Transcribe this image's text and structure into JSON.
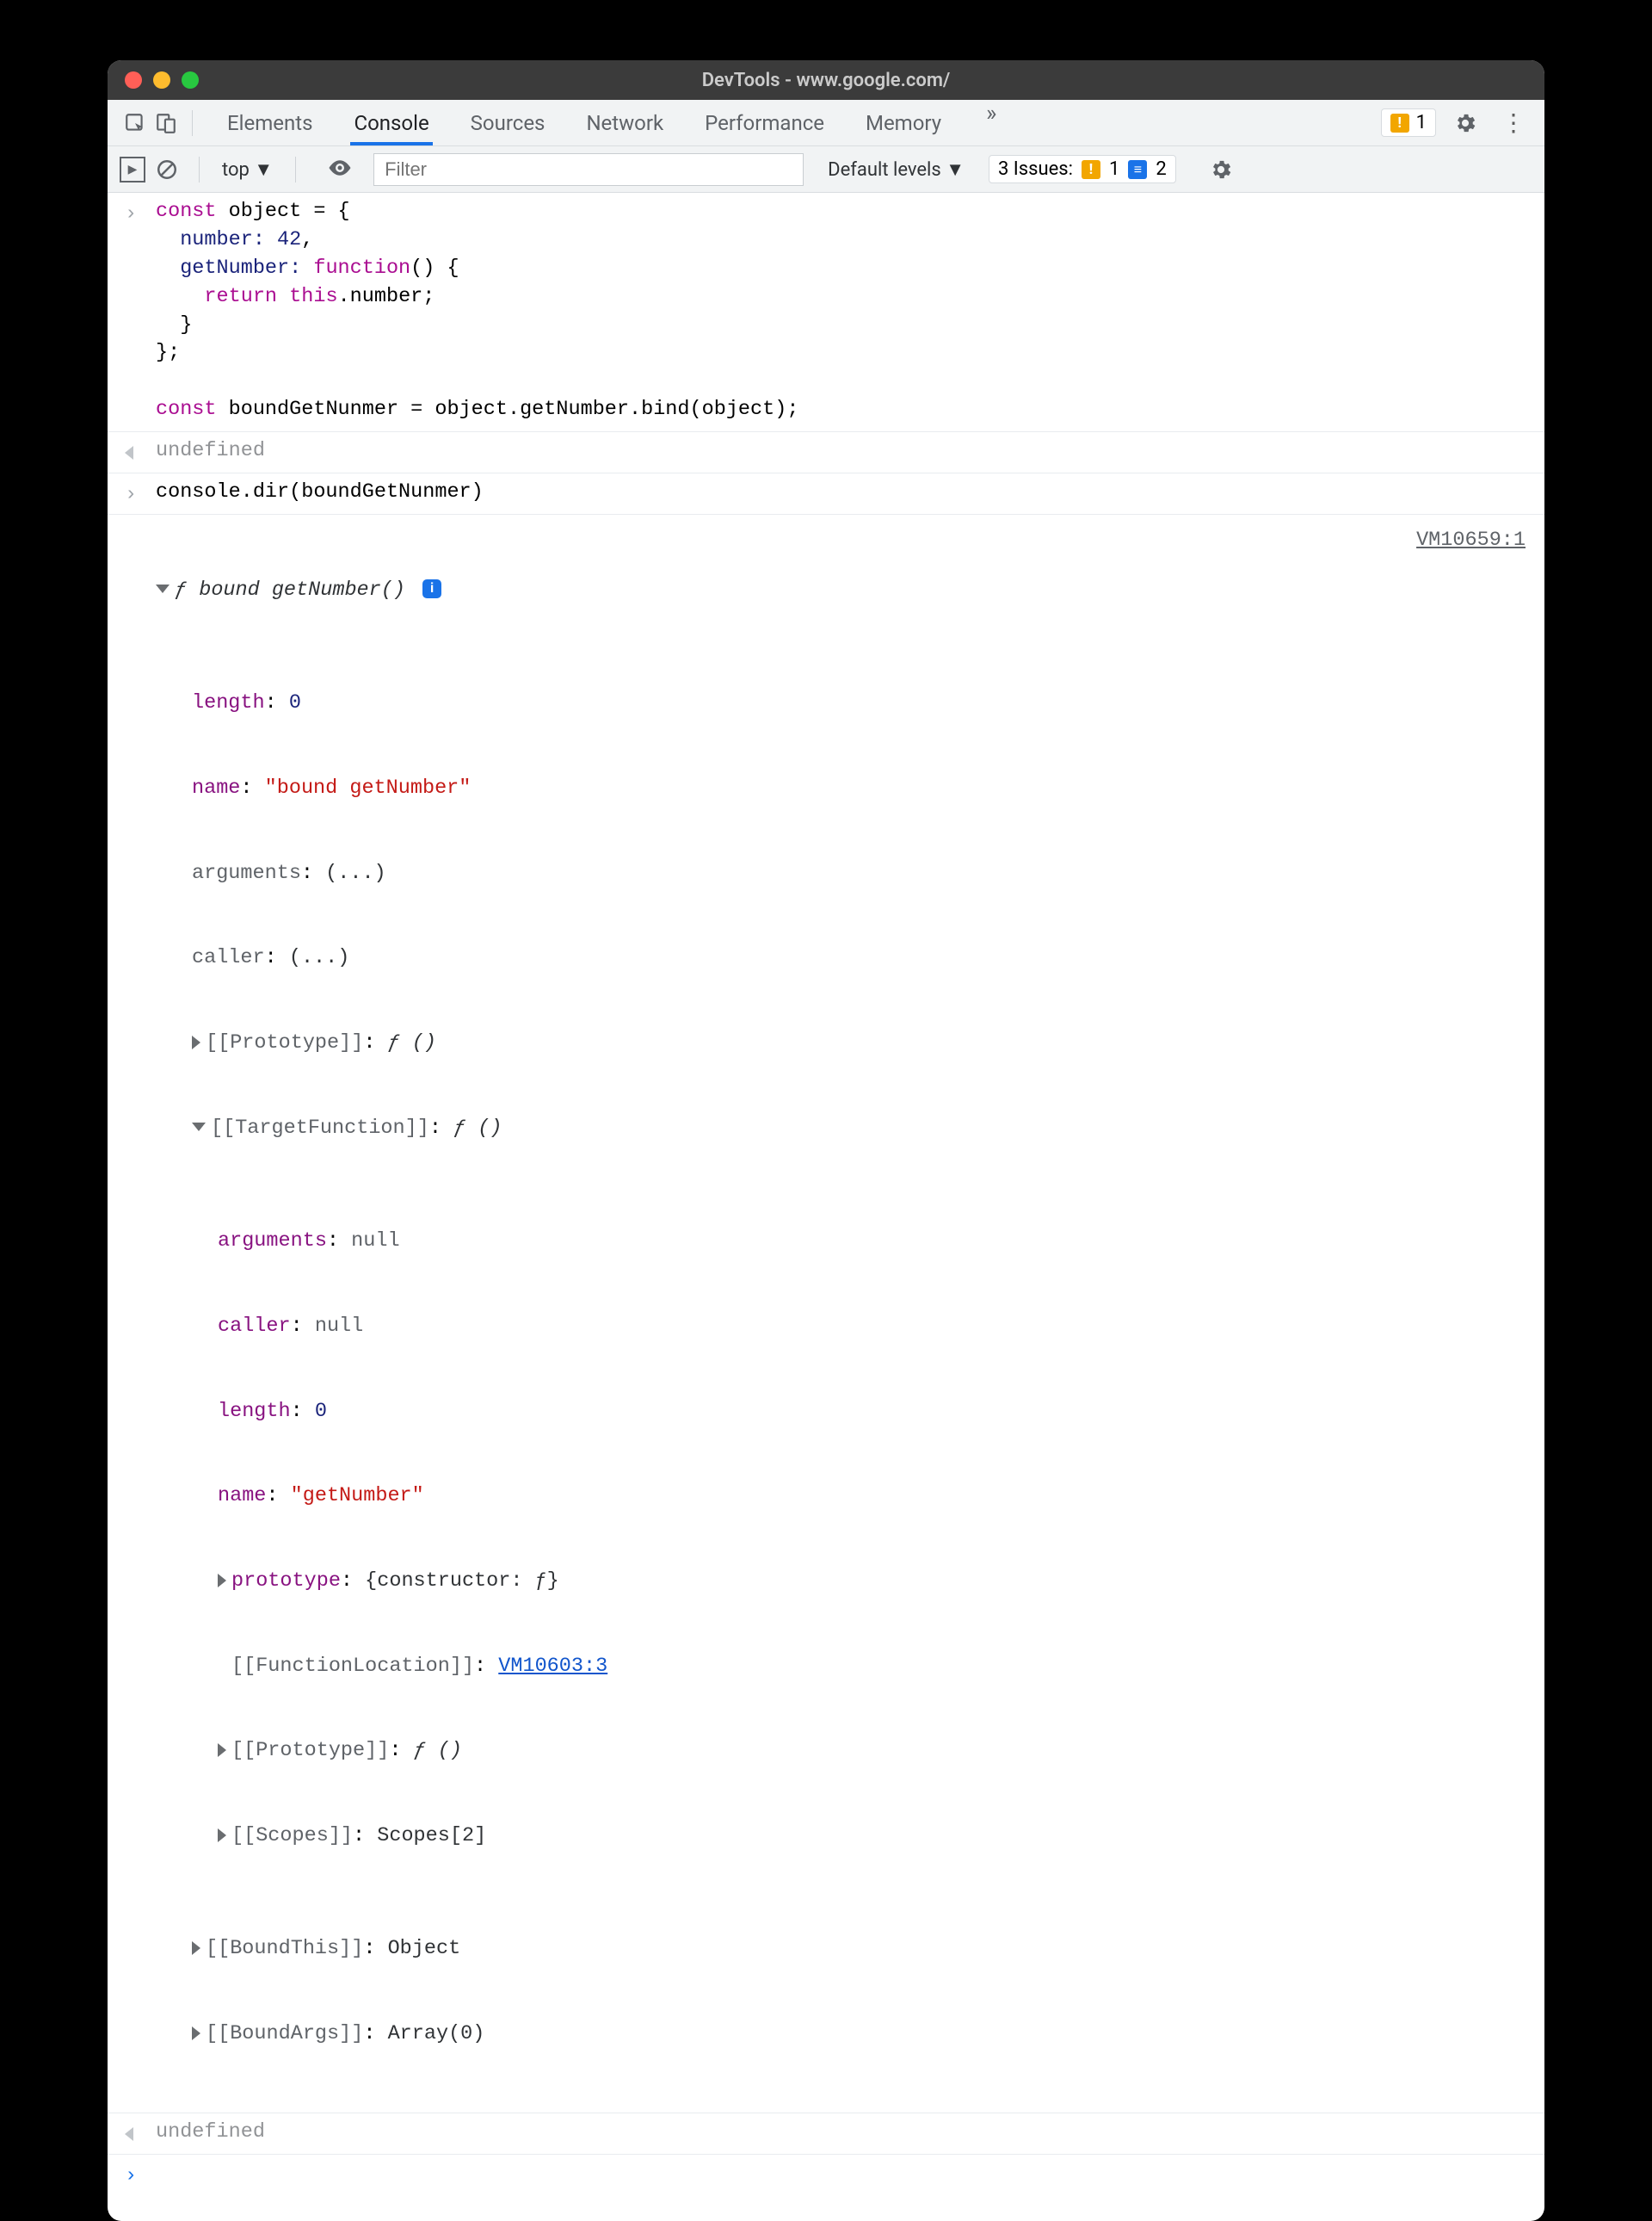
{
  "window_title": "DevTools - www.google.com/",
  "tabs": [
    "Elements",
    "Console",
    "Sources",
    "Network",
    "Performance",
    "Memory"
  ],
  "more_tabs_glyph": "»",
  "warn_count": "1",
  "filterbar": {
    "context": "top ▼",
    "filter_placeholder": "Filter",
    "levels": "Default levels ▼",
    "issues_label": "3 Issues:",
    "issues_warn": "1",
    "issues_info": "2"
  },
  "code": {
    "l1a": "const ",
    "l1b": "object = {",
    "l2a": "  number: ",
    "l2b": "42",
    "l2c": ",",
    "l3a": "  getNumber: ",
    "l3b": "function",
    "l3c": "() {",
    "l4a": "    ",
    "l4b": "return ",
    "l4c": "this",
    "l4d": ".number;",
    "l5": "  }",
    "l6": "};",
    "blank": "",
    "l7a": "const ",
    "l7b": "boundGetNunmer = object.getNumber.bind(object);"
  },
  "undefined_label": "undefined",
  "dir_call": "console.dir(boundGetNunmer)",
  "obj": {
    "header_prefix": "ƒ ",
    "header_name": "bound getNumber()",
    "vm": "VM10659:1",
    "length_k": "length",
    "length_v": "0",
    "name_k": "name",
    "name_v": "\"bound getNumber\"",
    "arguments_k": "arguments",
    "ellipsis": "(...)",
    "caller_k": "caller",
    "proto_k": "[[Prototype]]",
    "proto_v": "ƒ ()",
    "target_k": "[[TargetFunction]]",
    "target_v": "ƒ ()",
    "tf": {
      "arguments_k": "arguments",
      "null_v": "null",
      "caller_k": "caller",
      "length_k": "length",
      "length_v": "0",
      "name_k": "name",
      "name_v": "\"getNumber\"",
      "prototype_k": "prototype",
      "prototype_v": "{constructor: ƒ}",
      "funcloc_k": "[[FunctionLocation]]",
      "funcloc_v": "VM10603:3",
      "proto_k": "[[Prototype]]",
      "proto_v": "ƒ ()",
      "scopes_k": "[[Scopes]]",
      "scopes_v": "Scopes[2]"
    },
    "boundthis_k": "[[BoundThis]]",
    "boundthis_v": "Object",
    "boundargs_k": "[[BoundArgs]]",
    "boundargs_v": "Array(0)"
  }
}
